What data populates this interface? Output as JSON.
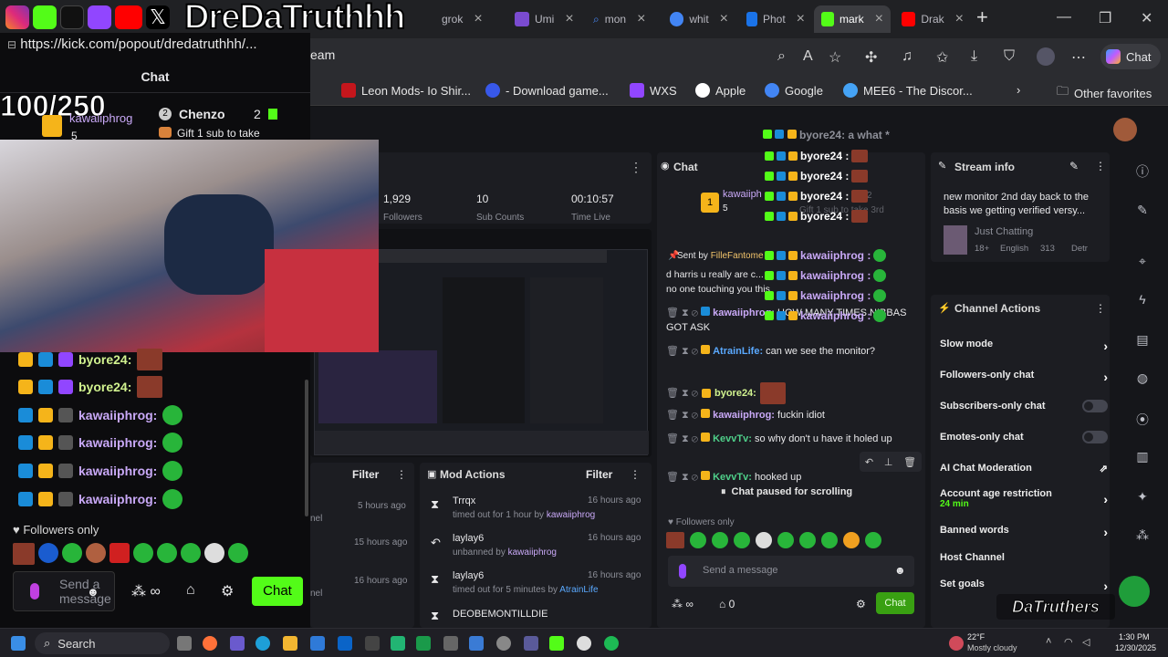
{
  "browser": {
    "overlay_title": "DreDaTruthhh",
    "tabs": [
      {
        "label": "grok",
        "color": "#4a8cff"
      },
      {
        "label": "Umi",
        "color": "#7a4bd0"
      },
      {
        "label": "mon",
        "color": "#4a8cff"
      },
      {
        "label": "whit",
        "color": "#4285f4"
      },
      {
        "label": "Phot",
        "color": "#1a73e8"
      },
      {
        "label": "mark",
        "color": "#53fc18"
      },
      {
        "label": "Drak",
        "color": "#ff0000"
      }
    ],
    "new_tab": "+",
    "address_fragment": "eam",
    "copilot_label": "Chat",
    "bookmarks": [
      {
        "label": "Leon Mods- Io Shir...",
        "color": "#c4161c"
      },
      {
        "label": "- Download game...",
        "color": "#3858e9"
      },
      {
        "label": "WXS",
        "color": "#9146ff"
      },
      {
        "label": "Apple",
        "color": "#ffffff"
      },
      {
        "label": "Google",
        "color": "#4285f4"
      },
      {
        "label": "MEE6 - The Discor...",
        "color": "#45a3f5"
      }
    ],
    "other_favorites": "Other favorites"
  },
  "popout": {
    "url": "https://kick.com/popout/dredatruthhh/...",
    "chat_title": "Chat",
    "sub_goal": "100/250",
    "leaderboard": {
      "first_user": "kawaiiphrog",
      "first_count": "5",
      "second_rank": "2",
      "second_user": "Chenzo",
      "second_count": "2",
      "gift_text": "Gift 1 sub to take"
    },
    "messages": [
      {
        "user": "byore24:",
        "user_color": "#d1f28f",
        "emote": "sq"
      },
      {
        "user": "byore24:",
        "user_color": "#d1f28f",
        "emote": "sq"
      },
      {
        "user": "kawaiiphrog:",
        "user_color": "#c9a9f7",
        "emote": "frog"
      },
      {
        "user": "kawaiiphrog:",
        "user_color": "#c9a9f7",
        "emote": "frog"
      },
      {
        "user": "kawaiiphrog:",
        "user_color": "#c9a9f7",
        "emote": "frog"
      },
      {
        "user": "kawaiiphrog:",
        "user_color": "#c9a9f7",
        "emote": "frog"
      }
    ],
    "followers_only": "Followers only",
    "send_placeholder": "Send a message",
    "infinity": "∞",
    "chat_button": "Chat"
  },
  "dashboard": {
    "stats": [
      {
        "value": "1,929",
        "label": "Followers"
      },
      {
        "value": "10",
        "label": "Sub Counts"
      },
      {
        "value": "00:10:57",
        "label": "Time Live"
      }
    ],
    "chat_panel": {
      "title": "Chat",
      "top_user": "kawaiiph",
      "top_count": "5",
      "pinned_label": "Sent by",
      "pinned_author": "FilleFantome",
      "pinned_text": "d harris u really are c... no one touching you this kick shit is yours big",
      "messages": [
        {
          "user": "kawaiiphrog:",
          "color": "#c9a9f7",
          "text": "HOW MANY TIMES NIBBAS GOT ASK"
        },
        {
          "user": "AtrainLife:",
          "color": "#5aa9ff",
          "text": "can we see the monitor?"
        },
        {
          "user": "byore24:",
          "color": "#d1f28f",
          "text": ""
        },
        {
          "user": "kawaiiphrog:",
          "color": "#c9a9f7",
          "text": "fuckin idiot"
        },
        {
          "user": "KevvTv:",
          "color": "#4fd08a",
          "text": "so why don't u have it holed up"
        },
        {
          "user": "KevvTv:",
          "color": "#4fd08a",
          "text": "hooked up"
        }
      ],
      "paused": "Chat paused for scrolling",
      "followers_only": "Followers only",
      "send_placeholder": "Send a message",
      "infinity": "∞",
      "gift_count": "0",
      "chat_button": "Chat"
    },
    "overlay_chat": {
      "top_line_user": "byore24",
      "top_line_text": ": a what *",
      "rows": [
        {
          "user": "byore24 :",
          "color": "#ffffff"
        },
        {
          "user": "byore24 :",
          "color": "#ffffff"
        },
        {
          "user": "byore24 :",
          "color": "#ffffff"
        },
        {
          "user": "byore24 :",
          "color": "#ffffff"
        },
        {
          "user": "kawaiiphrog :",
          "color": "#c9a9f7"
        },
        {
          "user": "kawaiiphrog :",
          "color": "#c9a9f7"
        },
        {
          "user": "kawaiiphrog :",
          "color": "#c9a9f7"
        },
        {
          "user": "kawaiiphrog :",
          "color": "#c9a9f7"
        }
      ],
      "ghost_gift": "Gift 1 sub to take 3rd",
      "ghost_count": "2"
    },
    "stream_info": {
      "title": "Stream info",
      "description": "new monitor 2nd day back to the basis we getting verified versy...",
      "category": "Just Chatting",
      "tags": [
        "18+",
        "English",
        "313",
        "Detr"
      ]
    },
    "channel_actions": {
      "title": "Channel Actions",
      "items": [
        {
          "label": "Slow mode",
          "control": "arrow"
        },
        {
          "label": "Followers-only chat",
          "control": "arrow"
        },
        {
          "label": "Subscribers-only chat",
          "control": "toggle"
        },
        {
          "label": "Emotes-only chat",
          "control": "toggle"
        },
        {
          "label": "AI Chat Moderation",
          "control": "external"
        },
        {
          "label": "Account age restriction",
          "control": "arrow",
          "sub": "24 min"
        },
        {
          "label": "Banned words",
          "control": "arrow"
        },
        {
          "label": "Host Channel",
          "control": "none"
        },
        {
          "label": "Set goals",
          "control": "arrow"
        }
      ]
    },
    "filter_panel": {
      "filter_label": "Filter",
      "times": [
        "5 hours ago",
        "15 hours ago",
        "16 hours ago"
      ],
      "side_text": "nel"
    },
    "mod_actions": {
      "title": "Mod Actions",
      "filter_label": "Filter",
      "items": [
        {
          "user": "Trrqx",
          "action": "timed out for 1 hour by",
          "by": "kawaiiphrog",
          "time": "16 hours ago",
          "icon": "hourglass"
        },
        {
          "user": "laylay6",
          "action": "unbanned by",
          "by": "kawaiiphrog",
          "time": "16 hours ago",
          "icon": "undo"
        },
        {
          "user": "laylay6",
          "action": "timed out for 5 minutes by",
          "by": "AtrainLife",
          "time": "16 hours ago",
          "icon": "hourglass"
        },
        {
          "user": "DEOBEMONTILLDIE",
          "action": "",
          "by": "",
          "time": "",
          "icon": "hourglass"
        }
      ]
    },
    "watermark": "DaTruthers"
  },
  "taskbar": {
    "search": "Search",
    "weather_temp": "22°F",
    "weather_desc": "Mostly cloudy",
    "time": "1:30 PM",
    "date": "12/30/2025"
  }
}
